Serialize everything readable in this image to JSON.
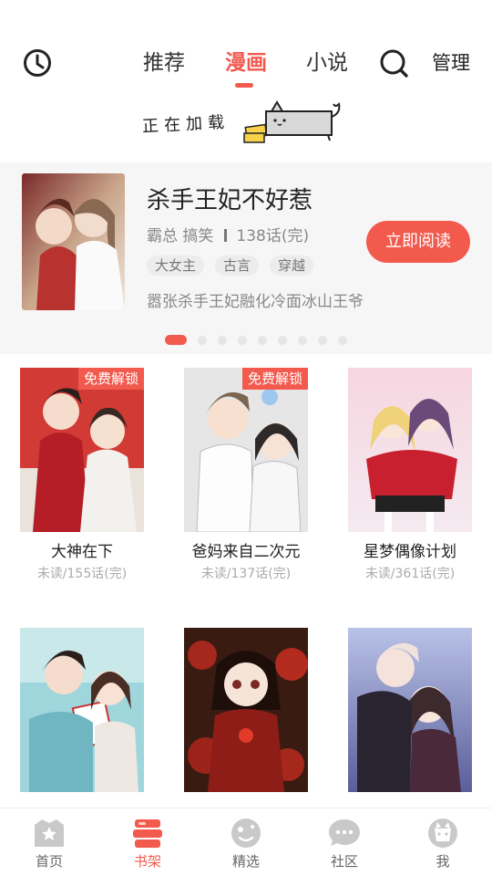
{
  "topnav": {
    "tabs": [
      {
        "label": "推荐",
        "active": false
      },
      {
        "label": "漫画",
        "active": true
      },
      {
        "label": "小说",
        "active": false
      }
    ],
    "manage_label": "管理",
    "history_icon": "clock-icon",
    "search_icon": "search-icon"
  },
  "loading": {
    "text": "正在加载"
  },
  "featured": {
    "title": "杀手王妃不好惹",
    "genres": "霸总 搞笑",
    "chapters": "138话(完)",
    "tags": [
      "大女主",
      "古言",
      "穿越"
    ],
    "description": "嚣张杀手王妃融化冷面冰山王爷",
    "read_button": "立即阅读",
    "carousel": {
      "total": 9,
      "active_index": 0
    }
  },
  "comics": [
    {
      "title": "大神在下",
      "progress": "未读/155话(完)",
      "badge": "免费解锁"
    },
    {
      "title": "爸妈来自二次元",
      "progress": "未读/137话(完)",
      "badge": "免费解锁"
    },
    {
      "title": "星梦偶像计划",
      "progress": "未读/361话(完)",
      "badge": ""
    },
    {
      "title": "",
      "progress": "",
      "badge": ""
    },
    {
      "title": "",
      "progress": "",
      "badge": ""
    },
    {
      "title": "",
      "progress": "",
      "badge": ""
    }
  ],
  "bottomnav": {
    "items": [
      {
        "label": "首页",
        "icon": "home-star-icon",
        "active": false
      },
      {
        "label": "书架",
        "icon": "bookshelf-icon",
        "active": true
      },
      {
        "label": "精选",
        "icon": "featured-face-icon",
        "active": false
      },
      {
        "label": "社区",
        "icon": "chat-bubble-icon",
        "active": false
      },
      {
        "label": "我",
        "icon": "profile-cat-icon",
        "active": false
      }
    ]
  },
  "colors": {
    "accent": "#f25a4e",
    "muted": "#888888",
    "inactive_icon": "#c9c9c9"
  }
}
